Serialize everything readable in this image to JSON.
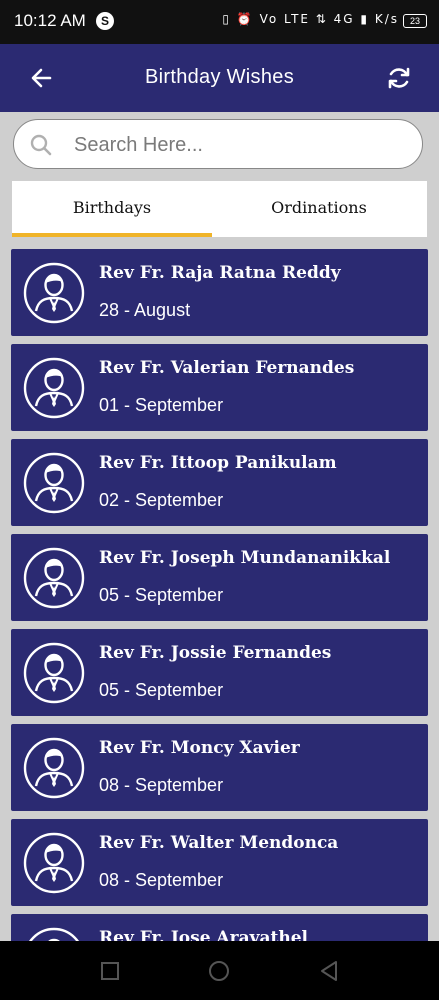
{
  "status": {
    "time": "10:12 AM",
    "app_badge": "S",
    "battery": "23",
    "indicators": "▯ ⏰ Vo LTE ⇅ 4G ▮ K/s"
  },
  "header": {
    "title": "Birthday Wishes"
  },
  "search": {
    "placeholder": "Search Here..."
  },
  "tabs": [
    {
      "label": "Birthdays",
      "active": true
    },
    {
      "label": "Ordinations",
      "active": false
    }
  ],
  "colors": {
    "primary": "#2b2a72",
    "tab_indicator": "#f0b429",
    "background": "#cfcfcf"
  },
  "people": [
    {
      "name": "Rev Fr. Raja Ratna Reddy",
      "date": "28 - August"
    },
    {
      "name": "Rev Fr. Valerian Fernandes",
      "date": "01 - September"
    },
    {
      "name": "Rev Fr. Ittoop Panikulam",
      "date": "02 - September"
    },
    {
      "name": "Rev Fr. Joseph Mundananikkal",
      "date": "05 - September"
    },
    {
      "name": "Rev Fr. Jossie Fernandes",
      "date": "05 - September"
    },
    {
      "name": "Rev Fr. Moncy Xavier",
      "date": "08 - September"
    },
    {
      "name": "Rev Fr. Walter Mendonca",
      "date": "08 - September"
    },
    {
      "name": "Rev Fr. Jose Aravathel",
      "date": ""
    }
  ]
}
